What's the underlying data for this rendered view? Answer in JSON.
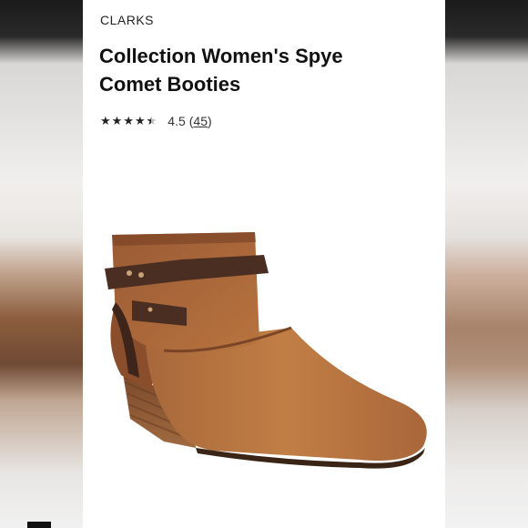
{
  "product": {
    "brand": "CLARKS",
    "title_line1": "Collection Women's Spye",
    "title_line2": "Comet Booties",
    "rating": {
      "stars_value": 4.5,
      "score_text": "4.5",
      "open_paren": "(",
      "count": "45",
      "close_paren": ")"
    },
    "image": {
      "icon": "ankle-boot-image"
    }
  },
  "colors": {
    "leather": "#b06d3c",
    "dark_strap": "#4a2e22",
    "heel": "#8e5a35"
  }
}
